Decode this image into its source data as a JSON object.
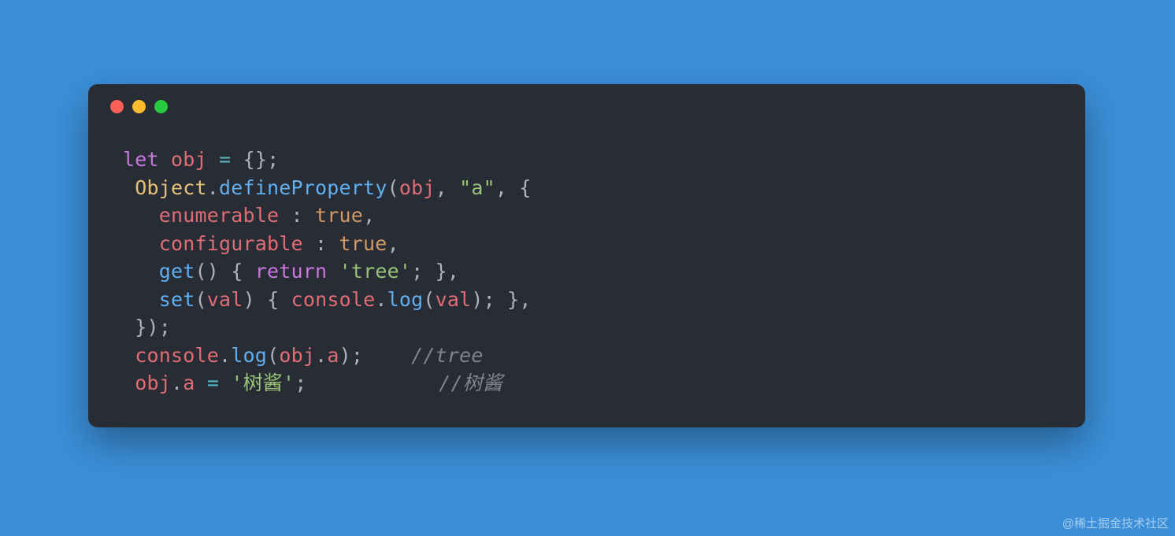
{
  "colors": {
    "bg": "#3b8fd9",
    "window": "#282c34",
    "red": "#ff5f56",
    "yellow": "#ffbd2e",
    "green": "#27c93f"
  },
  "code": {
    "line1": {
      "kw": "let",
      "sp1": " ",
      "name": "obj",
      "sp2": " ",
      "op": "=",
      "sp3": " ",
      "pun": "{};"
    },
    "line2": {
      "indent": " ",
      "obj": "Object",
      "dot": ".",
      "fn": "defineProperty",
      "open": "(",
      "arg1": "obj",
      "c1": ", ",
      "str": "\"a\"",
      "c2": ", {"
    },
    "line3": {
      "indent": "   ",
      "prop": "enumerable",
      "sep": " : ",
      "val": "true",
      "end": ","
    },
    "line4": {
      "indent": "   ",
      "prop": "configurable",
      "sep": " : ",
      "val": "true",
      "end": ","
    },
    "line5": {
      "indent": "   ",
      "fn": "get",
      "args": "() { ",
      "kw": "return",
      "sp": " ",
      "str": "'tree'",
      "end": "; },"
    },
    "line6": {
      "indent": "   ",
      "fn": "set",
      "open": "(",
      "arg": "val",
      "mid": ") { ",
      "obj": "console",
      "dot": ".",
      "fn2": "log",
      "open2": "(",
      "arg2": "val",
      "end": "); },"
    },
    "line7": {
      "indent": " ",
      "pun": "});"
    },
    "line8": {
      "indent": " ",
      "obj": "console",
      "dot": ".",
      "fn": "log",
      "open": "(",
      "arg": "obj",
      "dot2": ".",
      "prop": "a",
      "close": ");",
      "pad": "    ",
      "cmt": "//tree"
    },
    "line9": {
      "indent": " ",
      "obj": "obj",
      "dot": ".",
      "prop": "a",
      "sp": " ",
      "op": "=",
      "sp2": " ",
      "str": "'树酱'",
      "end": ";",
      "pad": "           ",
      "cmt": "//树酱"
    }
  },
  "watermark": "@稀土掘金技术社区"
}
